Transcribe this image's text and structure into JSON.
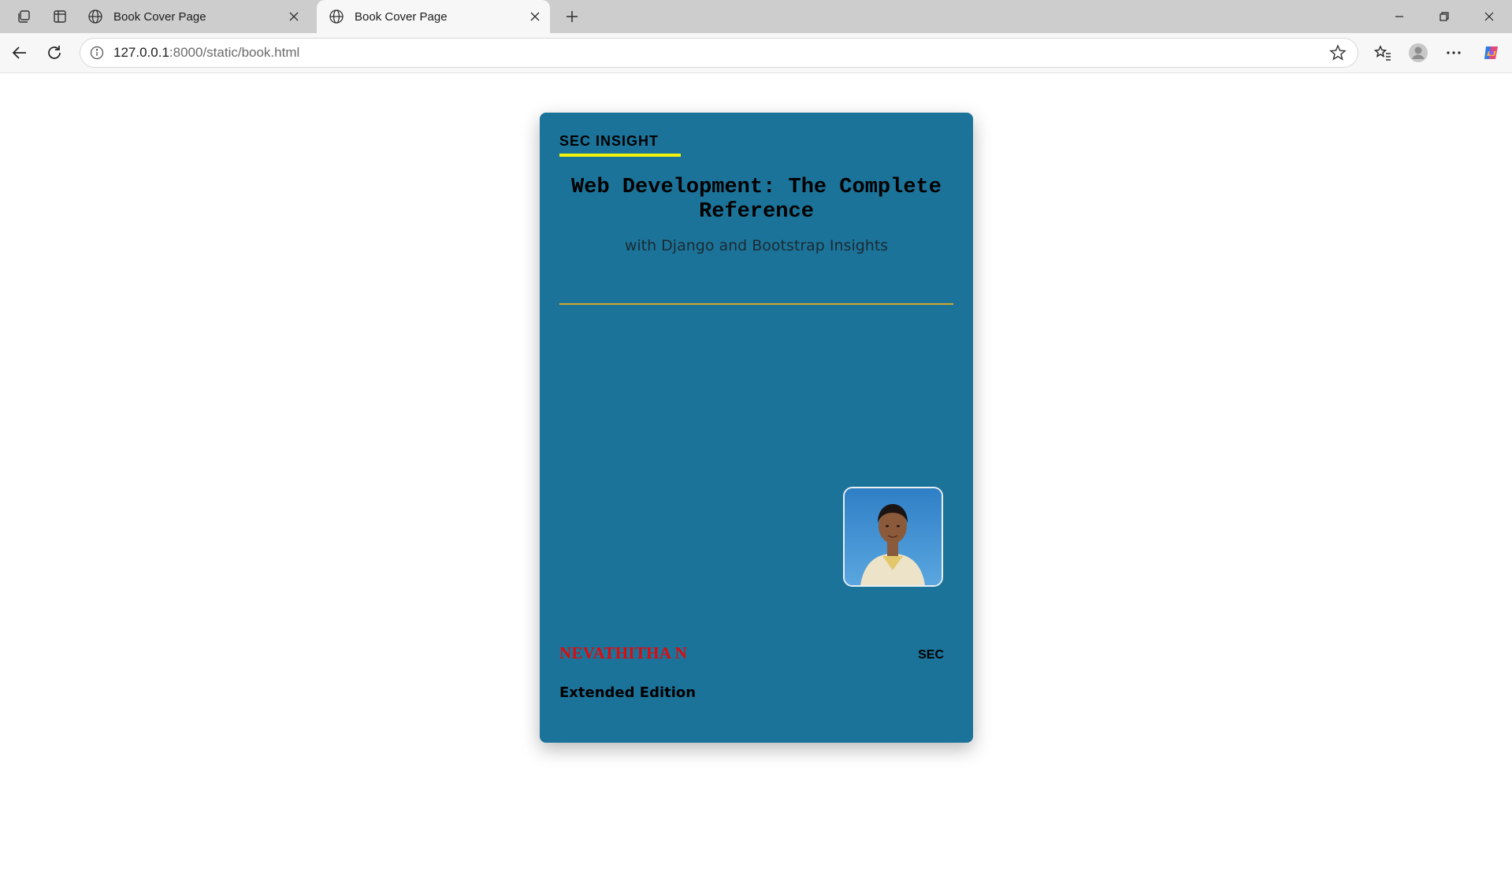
{
  "browser": {
    "tabs": [
      {
        "title": "Book Cover Page",
        "active": false
      },
      {
        "title": "Book Cover Page",
        "active": true
      }
    ],
    "address": {
      "host": "127.0.0.1",
      "rest": ":8000/static/book.html"
    }
  },
  "cover": {
    "brand": "SEC INSIGHT",
    "title": "Web Development: The Complete Reference",
    "subtitle": "with Django and Bootstrap Insights",
    "author": "NEVATHITHA N",
    "publisher": "SEC",
    "edition": "Extended Edition",
    "colors": {
      "background": "#1c7399",
      "brand_underline": "#f2f20a",
      "divider": "#d4a82a",
      "author": "#e00a0a"
    }
  }
}
